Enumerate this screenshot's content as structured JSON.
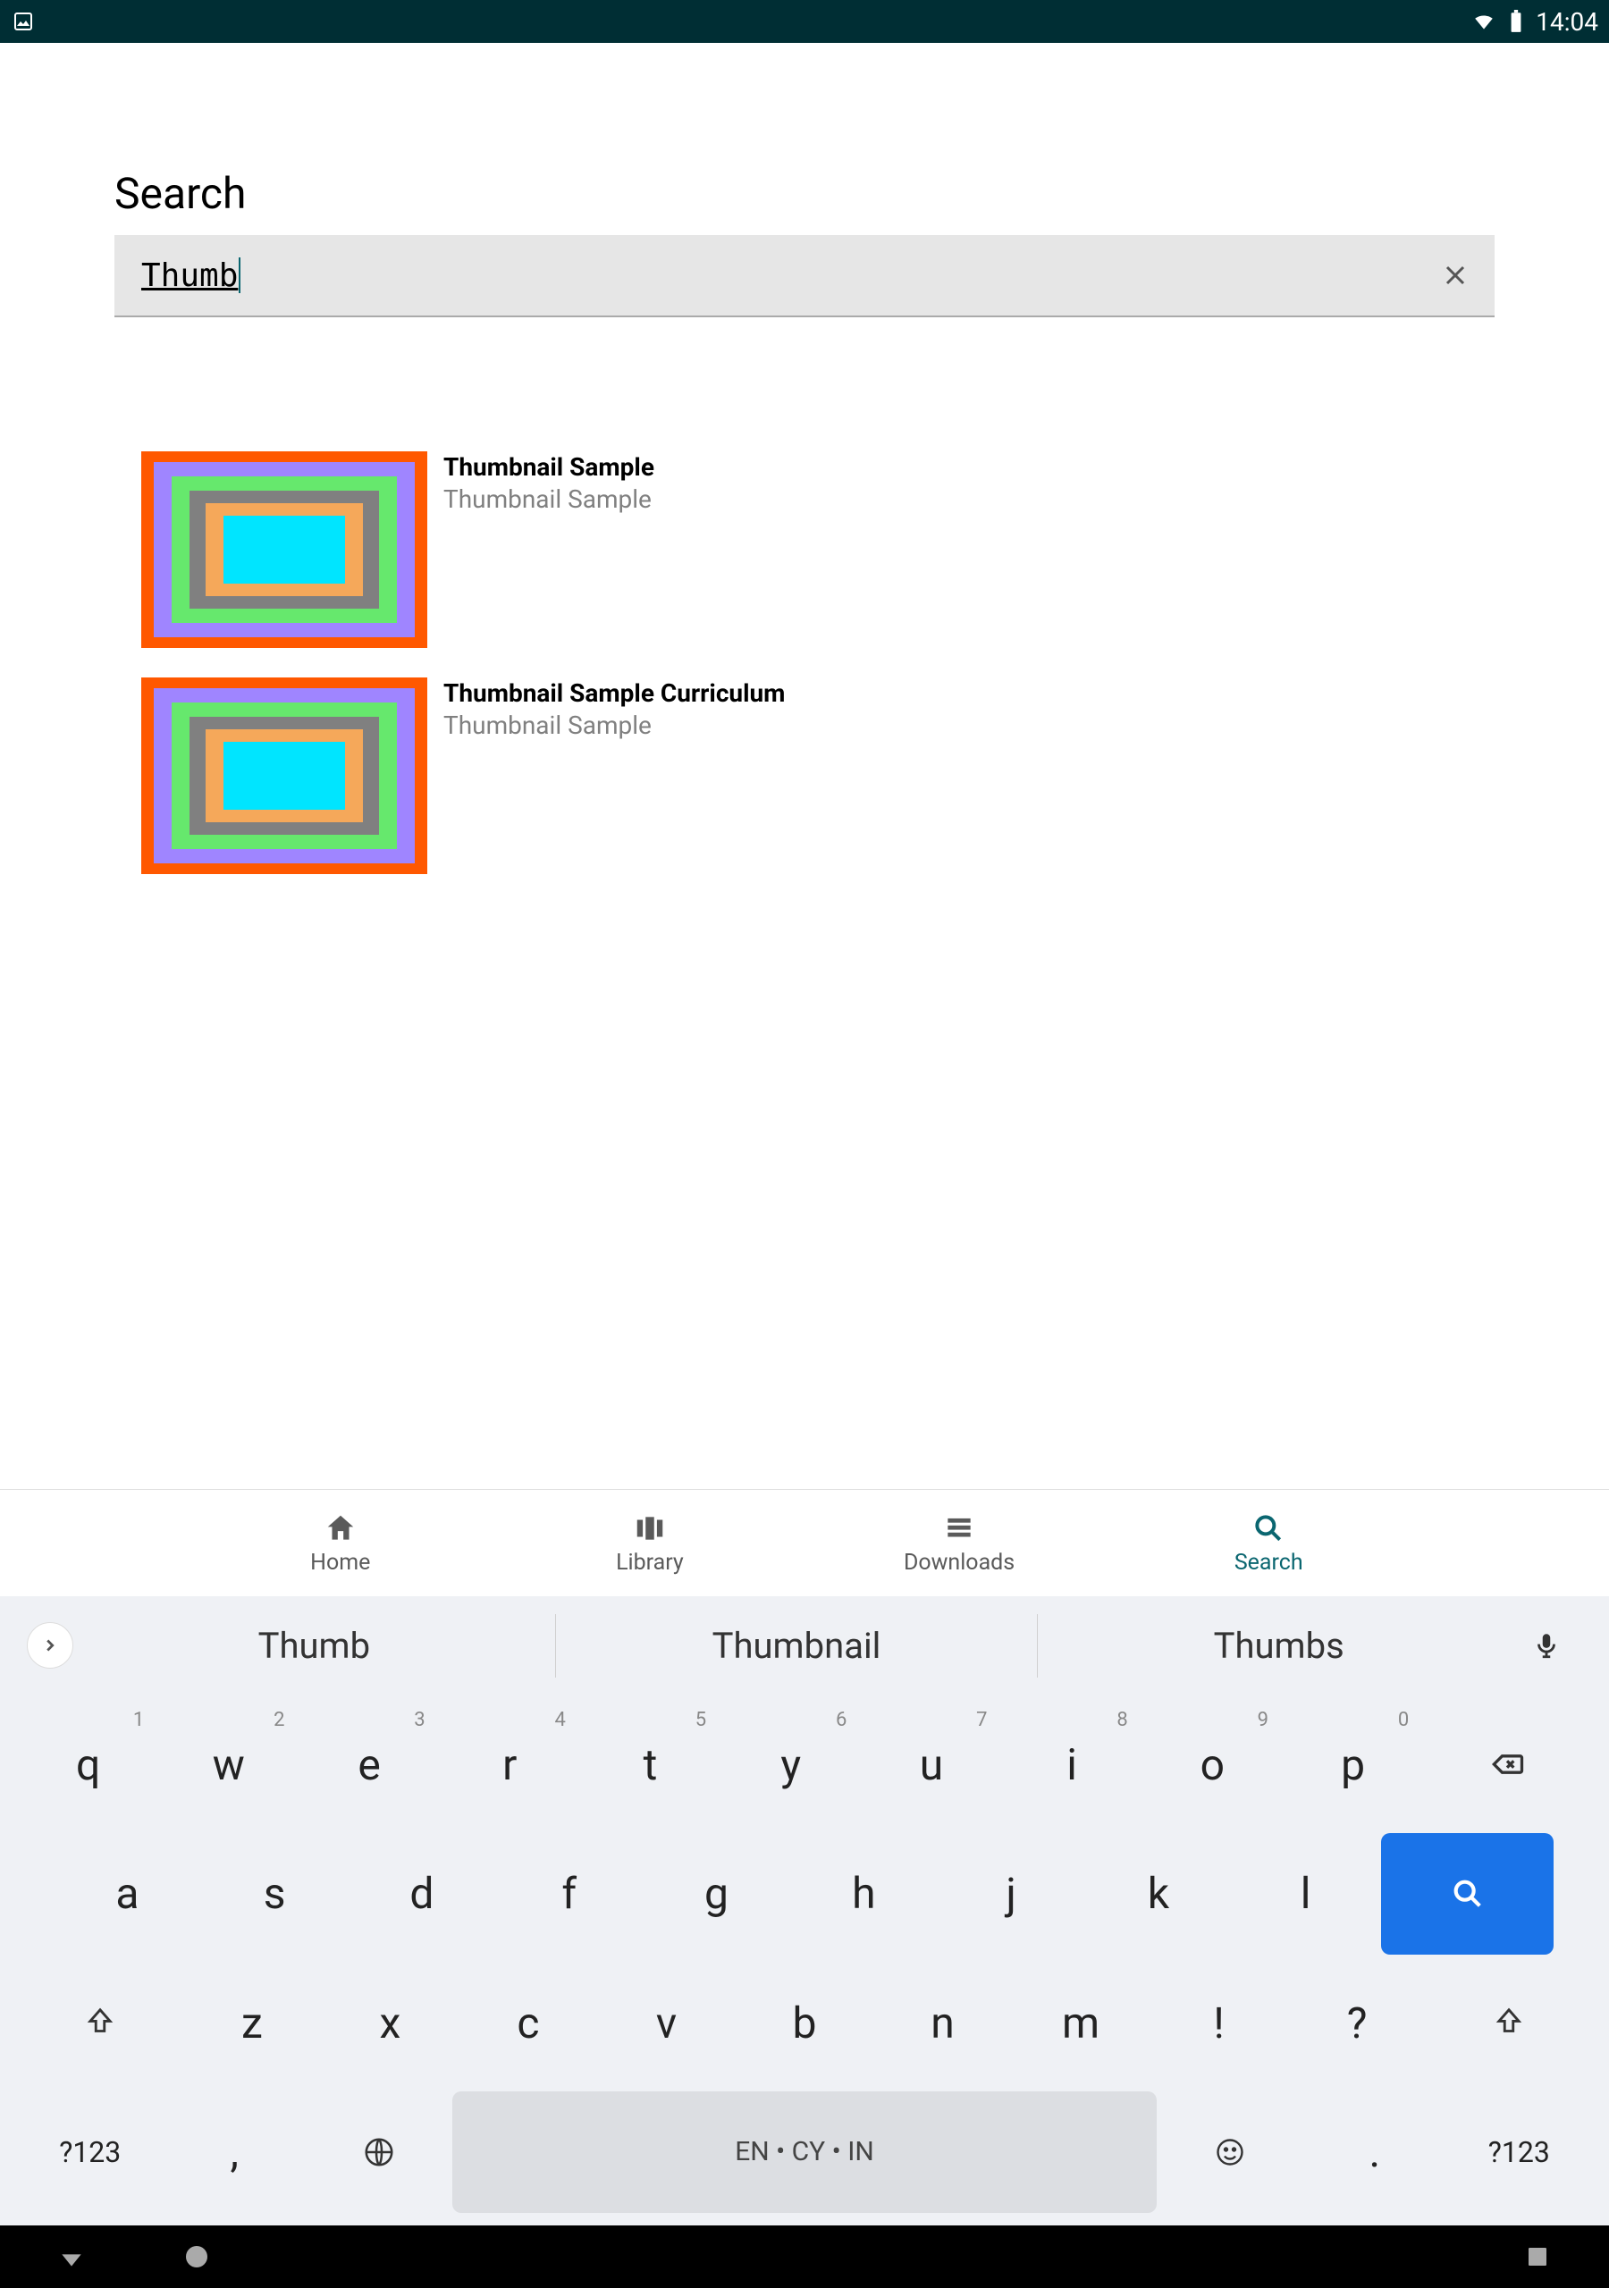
{
  "status": {
    "time": "14:04"
  },
  "search": {
    "title": "Search",
    "value": "Thumb"
  },
  "results": [
    {
      "title": "Thumbnail Sample",
      "subtitle": "Thumbnail Sample"
    },
    {
      "title": "Thumbnail Sample Curriculum",
      "subtitle": "Thumbnail Sample"
    }
  ],
  "nav": {
    "home": "Home",
    "library": "Library",
    "downloads": "Downloads",
    "search": "Search"
  },
  "keyboard": {
    "suggestions": [
      "Thumb",
      "Thumbnail",
      "Thumbs"
    ],
    "row1": [
      "q",
      "w",
      "e",
      "r",
      "t",
      "y",
      "u",
      "i",
      "o",
      "p"
    ],
    "hints1": [
      "1",
      "2",
      "3",
      "4",
      "5",
      "6",
      "7",
      "8",
      "9",
      "0"
    ],
    "row2": [
      "a",
      "s",
      "d",
      "f",
      "g",
      "h",
      "j",
      "k",
      "l"
    ],
    "row3": [
      "z",
      "x",
      "c",
      "v",
      "b",
      "n",
      "m",
      "!",
      "?"
    ],
    "sym": "?123",
    "comma": ",",
    "lang": "EN • CY • IN",
    "period": "."
  }
}
